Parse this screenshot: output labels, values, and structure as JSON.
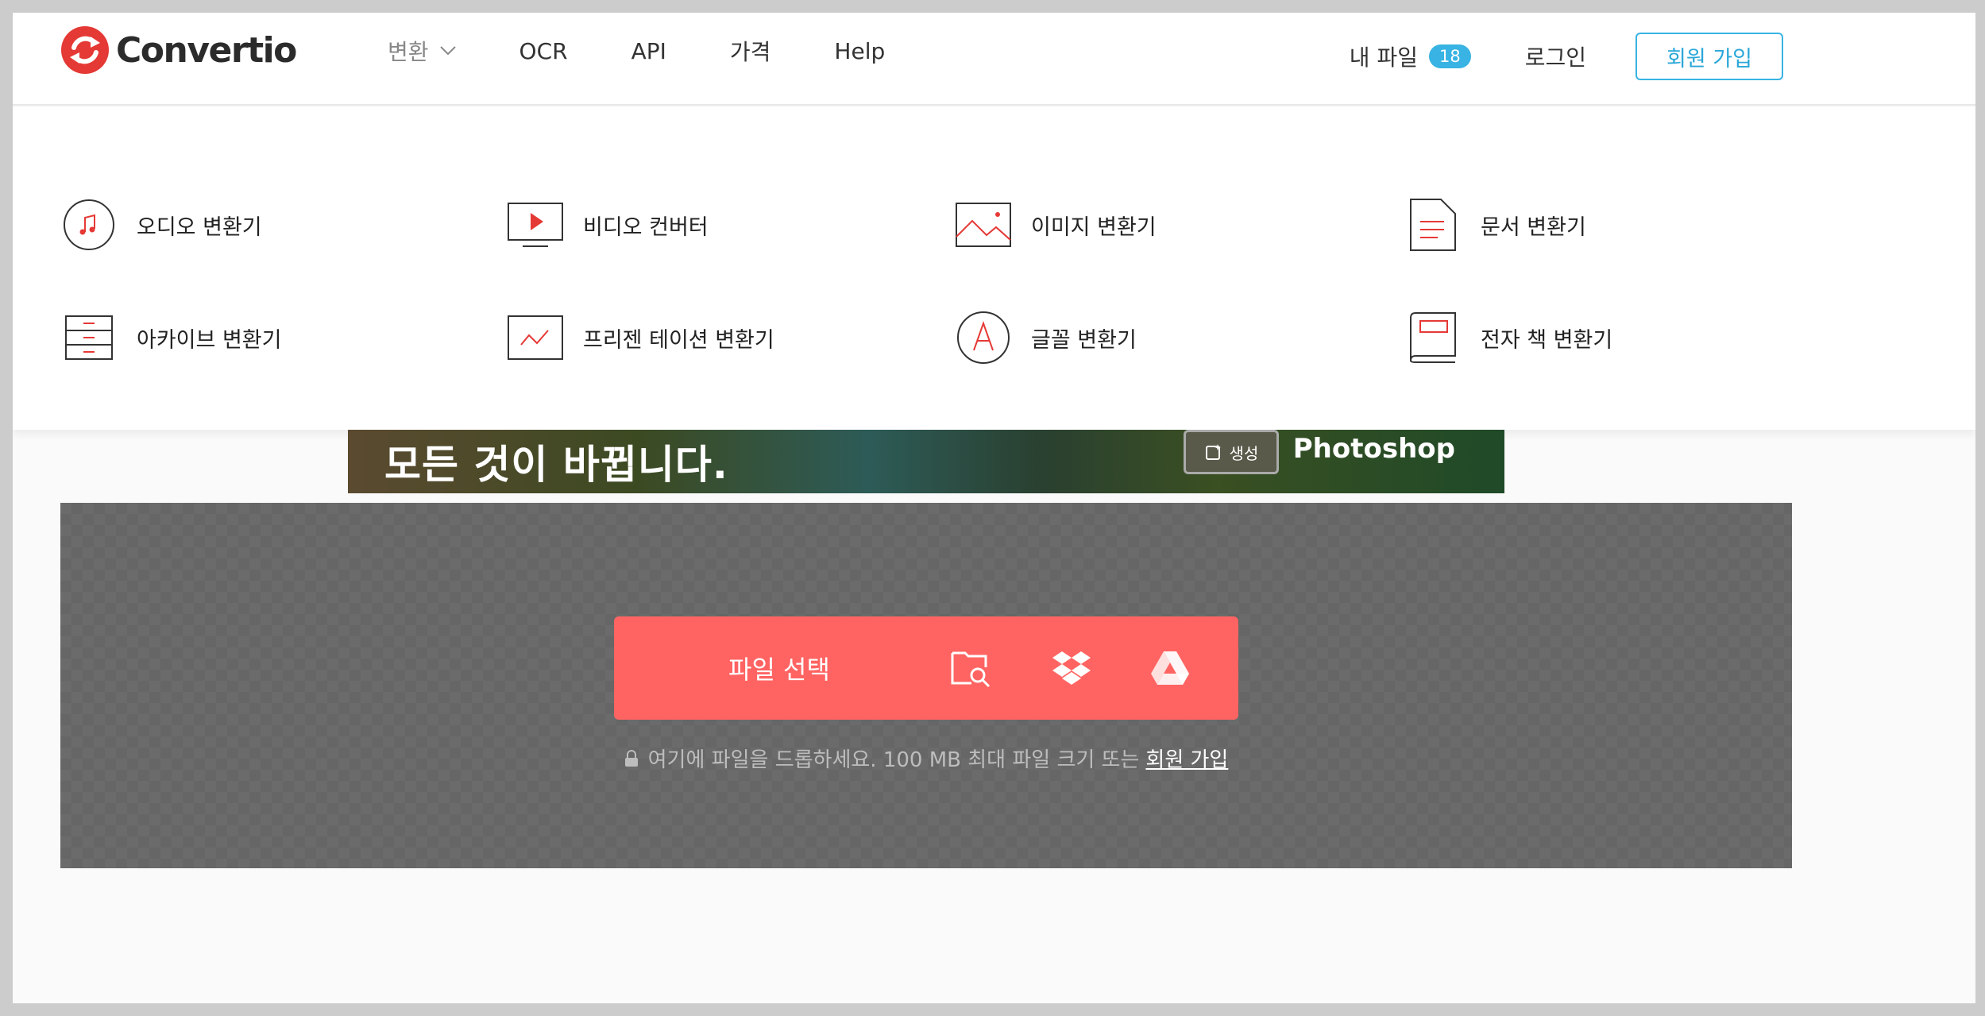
{
  "header": {
    "brand": "Convertio",
    "nav": [
      {
        "label": "변환",
        "has_dropdown": true,
        "active": true
      },
      {
        "label": "OCR"
      },
      {
        "label": "API"
      },
      {
        "label": "가격"
      },
      {
        "label": "Help"
      }
    ],
    "my_files_label": "내 파일",
    "my_files_count": "18",
    "login_label": "로그인",
    "signup_label": "회원 가입"
  },
  "dropdown": {
    "items": [
      {
        "label": "오디오 변환기",
        "icon": "audio-icon"
      },
      {
        "label": "비디오 컨버터",
        "icon": "video-icon"
      },
      {
        "label": "이미지 변환기",
        "icon": "image-icon"
      },
      {
        "label": "문서 변환기",
        "icon": "document-icon"
      },
      {
        "label": "아카이브 변환기",
        "icon": "archive-icon"
      },
      {
        "label": "프리젠 테이션 변환기",
        "icon": "presentation-icon"
      },
      {
        "label": "글꼴 변환기",
        "icon": "font-icon"
      },
      {
        "label": "전자 책 변환기",
        "icon": "ebook-icon"
      }
    ]
  },
  "banner": {
    "headline": "모든 것이 바뀝니다.",
    "button_label": "생성",
    "brand": "Photoshop"
  },
  "upload": {
    "choose_label": "파일 선택",
    "sources": [
      "folder-search-icon",
      "dropbox-icon",
      "google-drive-icon"
    ],
    "hint": "여기에 파일을 드롭하세요. 100 MB 최대 파일 크기 또는",
    "hint_link": "회원 가입"
  },
  "colors": {
    "accent_red": "#ff6462",
    "logo_red": "#e53935",
    "link_blue": "#38b3e3"
  }
}
